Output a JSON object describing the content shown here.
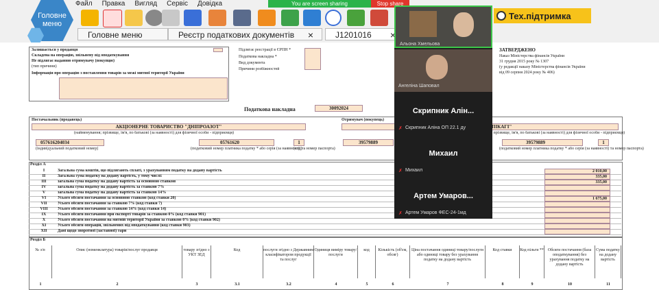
{
  "app": {
    "logo_text": "Головне меню",
    "menu": [
      "Файл",
      "Правка",
      "Вигляд",
      "Сервіс",
      "Довідка"
    ],
    "sharing_notice": "You are screen sharing",
    "stop_share": "Stop share",
    "support_label": "Тех.підтримка",
    "tabs": [
      {
        "label": "Головне меню"
      },
      {
        "label": "Реєстр податкових документів",
        "close": "×"
      },
      {
        "label": "J1201016",
        "close": "×"
      }
    ]
  },
  "video": {
    "participants": [
      {
        "name": "Альона Хмельова",
        "type": "video"
      },
      {
        "name": "Ангеліна Шаповал",
        "type": "video"
      },
      {
        "big": "Скрипник Алін...",
        "name": "Скрипник Аліна ОП 22.1 ду",
        "type": "muted"
      },
      {
        "big": "Михаил",
        "name": "Михаил",
        "type": "muted"
      },
      {
        "big": "Артем Умаров...",
        "name": "Артем Умаров ФЕС-24-1мд",
        "type": "muted"
      }
    ]
  },
  "document": {
    "approval": {
      "title": "ЗАТВЕРДЖЕНО",
      "line1": "Наказ Міністерства фінансів України",
      "line2": "31 грудня 2015 року № 1307",
      "line3": "(у редакції наказу Міністерства фінансів України",
      "line4": "від 09 серпня 2024 року № 406)"
    },
    "left_header_rows": [
      "Залишається у продавця",
      "Складена на операцію, звільнену від оподаткування",
      "Не підлягає наданню отримувачу (покупцю)",
      "(тип причини)",
      "Інформація про операцію з поставлення товарів за межі митної території України"
    ],
    "right_header_rows": [
      "Підлягає реєстрації в ЄРПН *",
      "Податкова накладна *",
      "Вид документа",
      "Причини розбіжностей"
    ],
    "title": "Податкова накладна",
    "number": "30092024",
    "seller": {
      "section_label": "Постачальник (продавець)",
      "name": "АКЦІОНЕРНЕ ТОВАРИСТВО \"ДНІПРОАЗОТ\"",
      "name_caption": "(найменування; прізвище, ім'я, по батькові (за наявності) для фізичної особи - підприємця)",
      "ipn": "057616204034",
      "ipn_caption": "(індивідуальний податковий номер)",
      "code": "05761620",
      "code_caption": "(податковий номер платника податку * або серія (за наявності) та номер паспорта)",
      "num": "1",
      "num_caption": "(код)"
    },
    "buyer": {
      "section_label": "Отримувач (покупець)",
      "name_tail": "ПІКАГІ\"",
      "name_caption": "(найменування; прізвище, ім'я, по батькові (за наявності) для фізичної особи - підприємця)",
      "ipn": "39579889",
      "code": "39579889",
      "num": "1",
      "code_caption": "(податковий номер платника податку * або серія (за наявності) та номер паспорта)"
    },
    "section_a": {
      "label": "Розділ А",
      "rows": [
        {
          "n": "I",
          "text": "Загальна сума коштів, що підлягають сплаті, з урахуванням податку на додану вартість",
          "value": "2 010,00"
        },
        {
          "n": "II",
          "text": "Загальна сума податку на додану вартість, у тому числі:",
          "value": "335,00"
        },
        {
          "n": "III",
          "text": "загальна сума податку на додану вартість за основною ставкою",
          "value": "335,00"
        },
        {
          "n": "IV",
          "text": "загальна сума податку на додану вартість за ставкою 7%",
          "value": ""
        },
        {
          "n": "V",
          "text": "загальна сума податку на додану вартість за ставкою 14%",
          "value": ""
        },
        {
          "n": "VI",
          "text": "Усього обсяги постачання за основною ставкою (код ставки 20)",
          "value": "1 675,00"
        },
        {
          "n": "VII",
          "text": "Усього обсяги постачання за ставкою 7% (код ставки 7)",
          "value": ""
        },
        {
          "n": "VIII",
          "text": "Усього обсяги постачання за ставкою 14% (код ставки 14)",
          "value": ""
        },
        {
          "n": "IX",
          "text": "Усього обсяги постачання при експорті товарів за ставкою 0% (код ставки 901)",
          "value": ""
        },
        {
          "n": "X",
          "text": "Усього обсяги постачання на митній території України за ставкою 0% (код ставки 902)",
          "value": ""
        },
        {
          "n": "XI",
          "text": "Усього обсяги операцій, звільнених від оподаткування (код ставки 903)",
          "value": ""
        },
        {
          "n": "XII",
          "text": "Дані щодо зворотної (заставної) тари",
          "value": ""
        }
      ]
    },
    "section_b": {
      "label": "Розділ Б",
      "headers": [
        "№ з/п",
        "Опис (номенклатура) товарів/послуг продавця",
        "товару згідно з УКТ ЗЕД",
        "Код",
        "послуги згідно з Державним класифікатором продукції та послуг",
        "Одиниця виміру товару/послуги",
        "код",
        "Кількість (об'єм, обсяг)",
        "Ціна постачання одиниці товару/послуги або одиниці товару без урахування податку на додану вартість",
        "Код ставки",
        "Код пільги **",
        "Обсяги постачання (база оподаткування) без урахування податку на додану вартість",
        "Сума податку на додану вартість"
      ],
      "column_numbers": [
        "1",
        "2",
        "3",
        "3.1",
        "3.2",
        "4",
        "5",
        "6",
        "7",
        "8",
        "9",
        "10",
        "11"
      ]
    }
  }
}
